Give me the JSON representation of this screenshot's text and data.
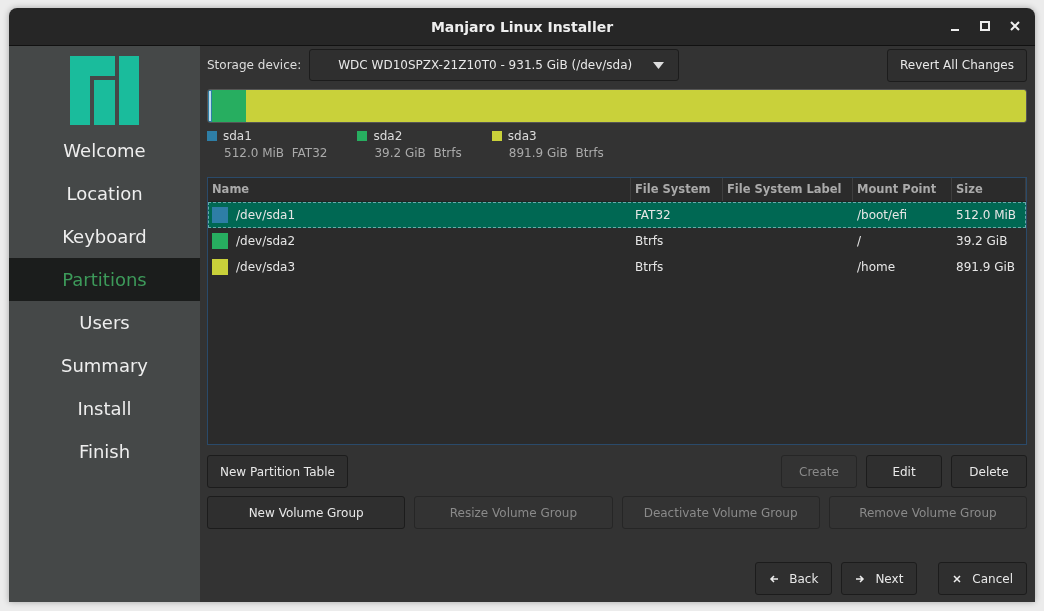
{
  "window": {
    "title": "Manjaro Linux Installer"
  },
  "sidebar": {
    "items": [
      {
        "label": "Welcome",
        "selected": false
      },
      {
        "label": "Location",
        "selected": false
      },
      {
        "label": "Keyboard",
        "selected": false
      },
      {
        "label": "Partitions",
        "selected": true
      },
      {
        "label": "Users",
        "selected": false
      },
      {
        "label": "Summary",
        "selected": false
      },
      {
        "label": "Install",
        "selected": false
      },
      {
        "label": "Finish",
        "selected": false
      }
    ]
  },
  "storage": {
    "label": "Storage device:",
    "value": "WDC WD10SPZX-21Z10T0 - 931.5 GiB (/dev/sda)",
    "revert_button": "Revert All Changes"
  },
  "partition_bar": {
    "segments": [
      {
        "color": "#2e7ea6",
        "level": 0.001,
        "selected": true
      },
      {
        "color": "#27ae60",
        "level": 0.042,
        "selected": false
      },
      {
        "color": "#c9d13a",
        "level": 0.957,
        "selected": false
      }
    ]
  },
  "partitions": [
    {
      "name": "sda1",
      "size": "512.0 MiB",
      "filesystem": "FAT32",
      "color": "#2e7ea6"
    },
    {
      "name": "sda2",
      "size": "39.2 GiB",
      "filesystem": "Btrfs",
      "color": "#27ae60"
    },
    {
      "name": "sda3",
      "size": "891.9 GiB",
      "filesystem": "Btrfs",
      "color": "#c9d13a"
    }
  ],
  "table": {
    "columns": [
      "Name",
      "File System",
      "File System Label",
      "Mount Point",
      "Size"
    ],
    "rows": [
      {
        "name": "/dev/sda1",
        "file_system": "FAT32",
        "mount_point": "/boot/efi",
        "size": "512.0 MiB",
        "color": "#2e7ea6",
        "selected": true
      },
      {
        "name": "/dev/sda2",
        "file_system": "Btrfs",
        "mount_point": "/",
        "size": "39.2 GiB",
        "color": "#27ae60",
        "selected": false
      },
      {
        "name": "/dev/sda3",
        "file_system": "Btrfs",
        "mount_point": "/home",
        "size": "891.9 GiB",
        "color": "#c9d13a",
        "selected": false
      }
    ]
  },
  "partition_buttons": [
    {
      "label": "New Partition Table",
      "disabled": false
    },
    {
      "label": "Create",
      "disabled": true
    },
    {
      "label": "Edit",
      "disabled": false
    },
    {
      "label": "Delete",
      "disabled": false
    }
  ],
  "volume_buttons": [
    {
      "label": "New Volume Group",
      "disabled": false
    },
    {
      "label": "Resize Volume Group",
      "disabled": true
    },
    {
      "label": "Deactivate Volume Group",
      "disabled": true
    },
    {
      "label": "Remove Volume Group",
      "disabled": true
    }
  ],
  "navigation": [
    {
      "label": "Back",
      "kind": "back"
    },
    {
      "label": "Next",
      "kind": "next"
    },
    {
      "label": "Cancel",
      "kind": "cancel"
    }
  ]
}
